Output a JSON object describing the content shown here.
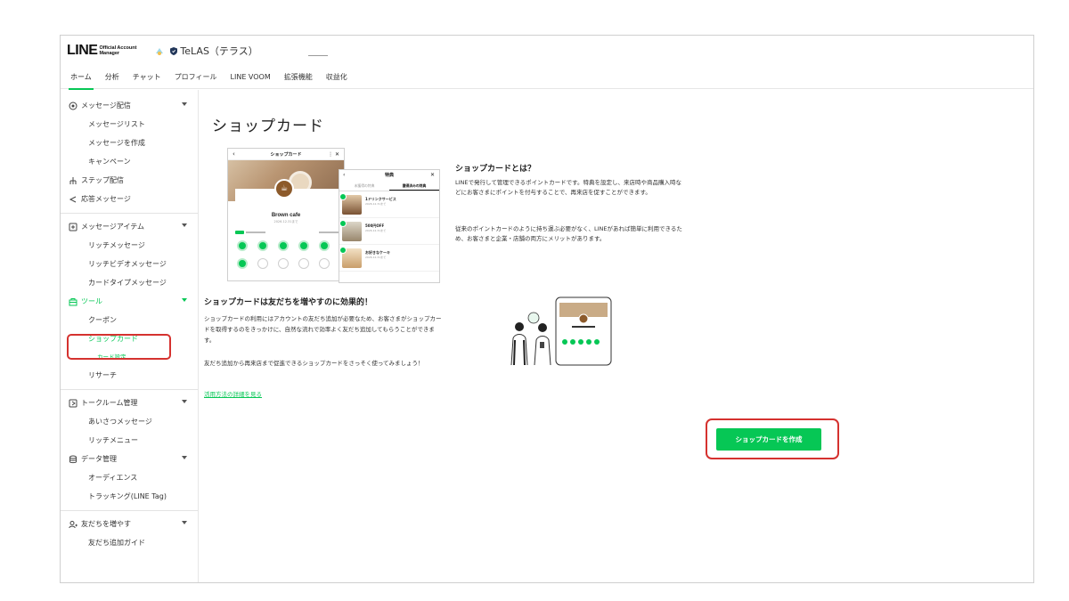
{
  "header": {
    "logo_text": "LINE",
    "logo_sub_1": "Official Account",
    "logo_sub_2": "Manager",
    "account_name": "TeLAS（テラス）"
  },
  "tabs": [
    "ホーム",
    "分析",
    "チャット",
    "プロフィール",
    "LINE VOOM",
    "拡張機能",
    "収益化"
  ],
  "sidebar": {
    "messages": {
      "label": "メッセージ配信",
      "items": [
        "メッセージリスト",
        "メッセージを作成",
        "キャンペーン"
      ]
    },
    "step": "ステップ配信",
    "auto_reply": "応答メッセージ",
    "items_section": {
      "label": "メッセージアイテム",
      "items": [
        "リッチメッセージ",
        "リッチビデオメッセージ",
        "カードタイプメッセージ"
      ]
    },
    "tools": {
      "label": "ツール",
      "items": [
        "クーポン",
        "ショップカード",
        "カード設定",
        "リサーチ"
      ]
    },
    "talkroom": {
      "label": "トークルーム管理",
      "items": [
        "あいさつメッセージ",
        "リッチメニュー"
      ]
    },
    "data": {
      "label": "データ管理",
      "items": [
        "オーディエンス",
        "トラッキング(LINE Tag)"
      ]
    },
    "friends": {
      "label": "友だちを増やす",
      "items": [
        "友だち追加ガイド"
      ]
    }
  },
  "main": {
    "title": "ショップカード",
    "about_title": "ショップカードとは？",
    "about_text_1": "LINEで発行して管理できるポイントカードです。特典を設定し、来店時や商品購入時などにお客さまにポイントを付与することで、再来店を促すことができます。",
    "about_text_2": "従来のポイントカードのように持ち運ぶ必要がなく、LINEがあれば簡単に利用できるため、お客さまと企業・店舗の両方にメリットがあります。",
    "friends_title": "ショップカードは友だちを増やすのに効果的！",
    "friends_text_1": "ショップカードの利用にはアカウントの友だち追加が必要なため、お客さまがショップカードを取得するのをきっかけに、自然な流れで効率よく友だち追加してもらうことができます。",
    "friends_text_2": "友だち追加から再来店まで促進できるショップカードをさっそく使ってみましょう！",
    "link": "活用方法の詳細を見る",
    "create_button": "ショップカードを作成"
  },
  "mock_card": {
    "header": "ショップカード",
    "shop_name": "Brown cafe",
    "valid": "2026.12.31まで",
    "stamps_filled": 6,
    "stamps_total": 10
  },
  "mock_rewards": {
    "header": "特典",
    "tab_1": "未獲得の特典",
    "tab_2": "獲得済みの特典",
    "rewards": [
      {
        "title": "1ドリンクサービス",
        "sub": "2026.12.31まで"
      },
      {
        "title": "500円OFF",
        "sub": "2026.12.31まで"
      },
      {
        "title": "お好きなケーキ",
        "sub": "2026.12.31まで"
      }
    ]
  },
  "colors": {
    "accent": "#06c755",
    "highlight": "#d5322f"
  }
}
